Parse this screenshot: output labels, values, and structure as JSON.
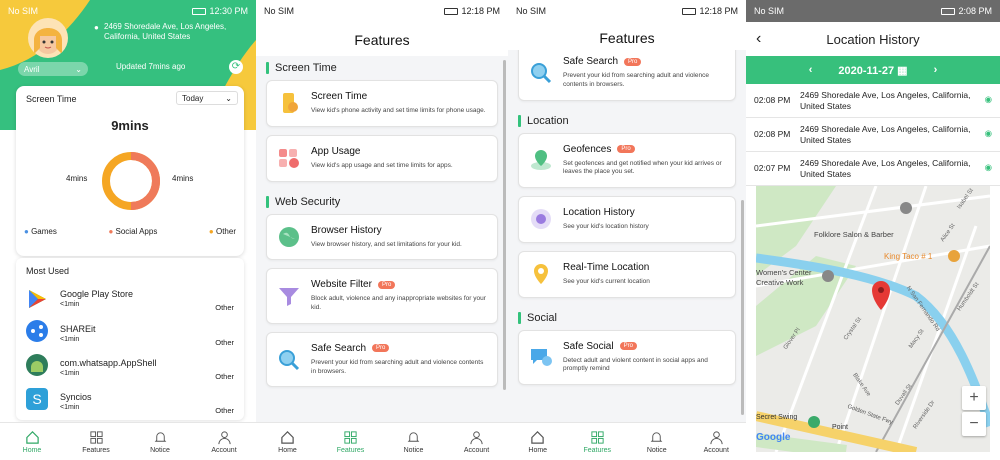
{
  "p1": {
    "status": {
      "left": "No SIM",
      "time": "12:30 PM"
    },
    "address": "2469 Shoredale Ave, Los Angeles, California, United States",
    "child": "Avril",
    "updated": "Updated 7mins ago",
    "screen_time_label": "Screen Time",
    "period": "Today",
    "total": "9mins",
    "left_val": "4mins",
    "right_val": "4mins",
    "legend": [
      {
        "label": "Games",
        "color": "#4a90e2"
      },
      {
        "label": "Social Apps",
        "color": "#ef7a5a"
      },
      {
        "label": "Other",
        "color": "#f5a623"
      }
    ],
    "most_used_label": "Most Used",
    "apps": [
      {
        "name": "Google Play Store",
        "time": "<1min",
        "cat": "Other"
      },
      {
        "name": "SHAREit",
        "time": "<1min",
        "cat": "Other"
      },
      {
        "name": "com.whatsapp.AppShell",
        "time": "<1min",
        "cat": "Other"
      },
      {
        "name": "Syncios",
        "time": "<1min",
        "cat": "Other"
      }
    ]
  },
  "p2": {
    "status": {
      "left": "No SIM",
      "time": "12:18 PM"
    },
    "title": "Features",
    "sections": [
      {
        "label": "Screen Time",
        "items": [
          {
            "title": "Screen Time",
            "desc": "View kid's phone activity and set time limits for phone usage.",
            "pro": false,
            "icon": "phone-icon"
          },
          {
            "title": "App Usage",
            "desc": "View kid's app usage and set time limits for apps.",
            "pro": false,
            "icon": "apps-icon"
          }
        ]
      },
      {
        "label": "Web Security",
        "items": [
          {
            "title": "Browser History",
            "desc": "View browser history, and set limitations for your kid.",
            "pro": false,
            "icon": "globe-icon"
          },
          {
            "title": "Website Filter",
            "desc": "Block adult, violence and any inappropriate websites for your kid.",
            "pro": true,
            "icon": "filter-icon"
          },
          {
            "title": "Safe Search",
            "desc": "Prevent your kid from searching adult and violence contents in browsers.",
            "pro": true,
            "icon": "search-icon"
          }
        ]
      }
    ]
  },
  "p3": {
    "status": {
      "left": "No SIM",
      "time": "12:18 PM"
    },
    "title": "Features",
    "top_item": {
      "title": "Safe Search",
      "desc": "Prevent your kid from searching adult and violence contents in browsers.",
      "pro": true
    },
    "sections": [
      {
        "label": "Location",
        "items": [
          {
            "title": "Geofences",
            "desc": "Set geofences and get notified when your kid arrives or leaves the place you set.",
            "pro": true,
            "icon": "geofence-icon"
          },
          {
            "title": "Location History",
            "desc": "See your kid's location history",
            "pro": false,
            "icon": "history-icon"
          },
          {
            "title": "Real-Time Location",
            "desc": "See your kid's current location",
            "pro": false,
            "icon": "pin-icon"
          }
        ]
      },
      {
        "label": "Social",
        "items": [
          {
            "title": "Safe Social",
            "desc": "Detect adult and violent content in social apps and promptly remind",
            "pro": true,
            "icon": "chat-icon"
          }
        ]
      }
    ]
  },
  "p4": {
    "status": {
      "left": "No SIM",
      "time": "2:08 PM"
    },
    "title": "Location History",
    "date": "2020-11-27",
    "entries": [
      {
        "time": "02:08 PM",
        "address": "2469 Shoredale Ave, Los Angeles, California, United States"
      },
      {
        "time": "02:08 PM",
        "address": "2469 Shoredale Ave, Los Angeles, California, United States"
      },
      {
        "time": "02:07 PM",
        "address": "2469 Shoredale Ave, Los Angeles, California, United States"
      }
    ],
    "map": {
      "labels": [
        "Folklore Salon & Barber",
        "King Taco # 1",
        "Women's Center Creative Work",
        "Secret Swing",
        "Point",
        "Golden State Fwy",
        "Google",
        "N San Fernando Rd",
        "Crystal St",
        "Glover Pl",
        "Blake Ave",
        "Isabel St",
        "Alice St",
        "Humboldt St",
        "Macy St",
        "Duvall St",
        "Riverside Dr"
      ],
      "zoom_in": "+",
      "zoom_out": "−"
    }
  },
  "pro_label": "Pro",
  "tabs": [
    "Home",
    "Features",
    "Notice",
    "Account"
  ]
}
